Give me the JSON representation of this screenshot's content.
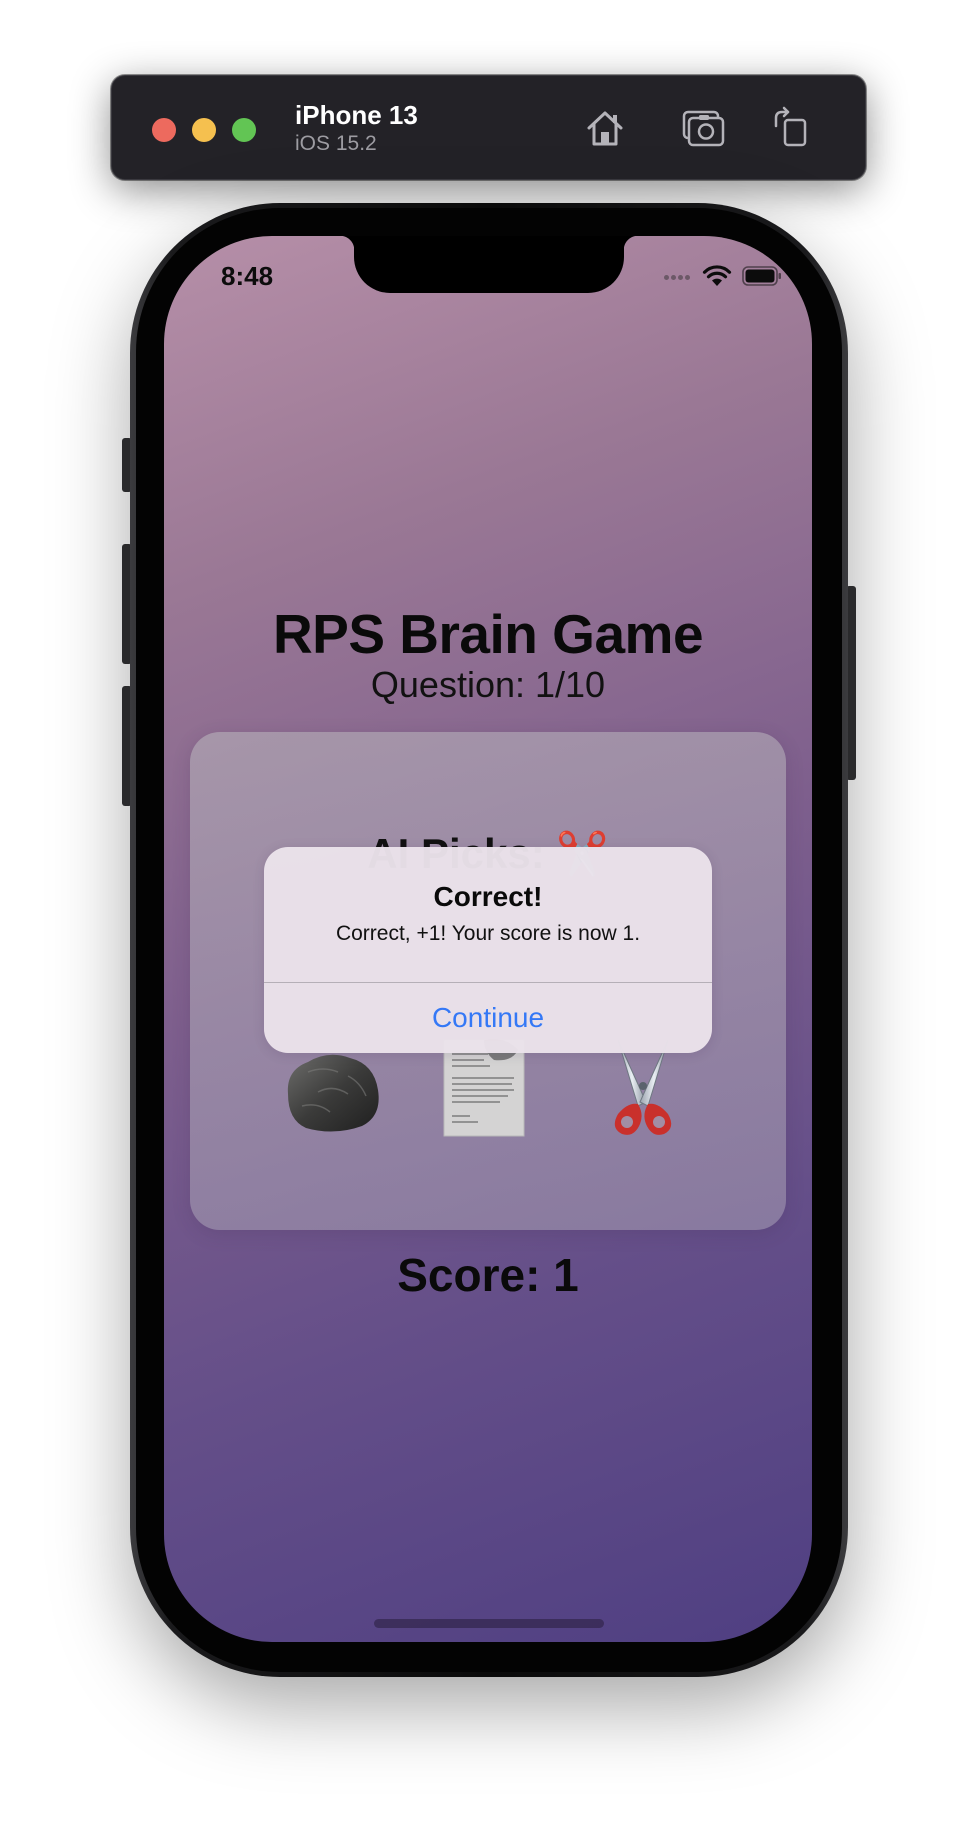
{
  "simulator": {
    "device_name": "iPhone 13",
    "os_version": "iOS 15.2",
    "buttons": [
      {
        "name": "home-icon"
      },
      {
        "name": "screenshot-icon"
      },
      {
        "name": "rotate-icon"
      }
    ]
  },
  "status_bar": {
    "time": "8:48",
    "icons": [
      "cellular-signal-icon",
      "wifi-icon",
      "battery-icon"
    ]
  },
  "app": {
    "title": "RPS Brain Game",
    "question": "Question: 1/10",
    "ai_picks": "AI Picks: ✂️",
    "choices": [
      {
        "name": "rock",
        "icon": "rock-icon"
      },
      {
        "name": "paper",
        "icon": "paper-icon"
      },
      {
        "name": "scissors",
        "icon": "scissors-icon"
      }
    ],
    "score": "Score: 1"
  },
  "alert": {
    "title": "Correct!",
    "message": "Correct, +1! Your score is now 1.",
    "button_label": "Continue"
  },
  "colors": {
    "alert_button": "#3478f6",
    "background_top": "#b68fa8",
    "background_bottom": "#4f3f82",
    "traffic_red": "#ed6a5e",
    "traffic_yellow": "#f5c04f",
    "traffic_green": "#62c554"
  }
}
